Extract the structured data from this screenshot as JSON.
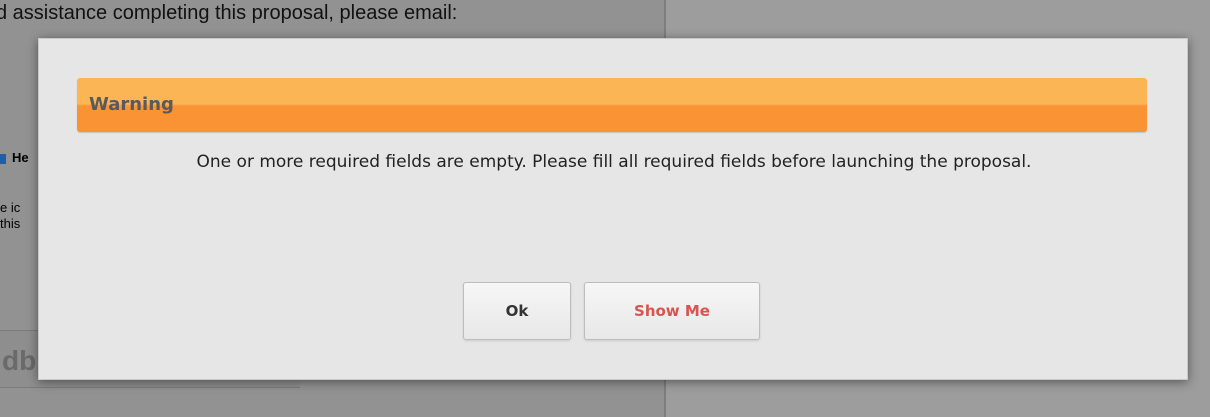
{
  "background": {
    "top_text": "d assistance completing this proposal, please email:",
    "help_label": "He",
    "small_lines": [
      "e ic",
      "this"
    ],
    "box_text": "db"
  },
  "dialog": {
    "title": "Warning",
    "message": "One or more required fields are empty. Please fill all required fields before launching the proposal.",
    "ok_label": "Ok",
    "show_me_label": "Show Me",
    "colors": {
      "header_top": "#fcb555",
      "header_bottom": "#fa9333",
      "show_me_text": "#d9534f"
    }
  }
}
